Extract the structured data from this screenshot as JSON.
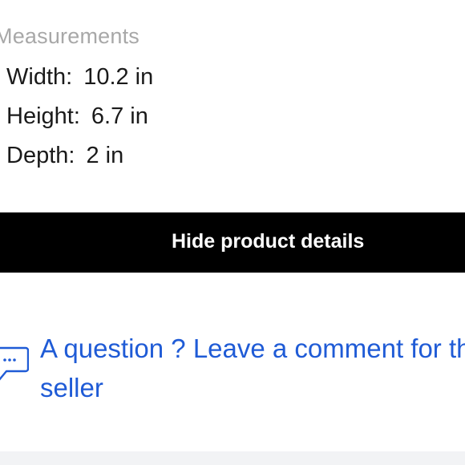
{
  "measurements": {
    "title": "Measurements",
    "rows": [
      {
        "label": "Width:",
        "value": "10.2 in"
      },
      {
        "label": "Height:",
        "value": "6.7 in"
      },
      {
        "label": "Depth:",
        "value": "2 in"
      }
    ]
  },
  "details_toggle": {
    "label": "Hide product details"
  },
  "question": {
    "line1": "A question ? Leave a comment for the",
    "line2": "seller",
    "icon": "comment-icon"
  },
  "colors": {
    "link": "#1f5bd6",
    "button_bg": "#000000",
    "muted": "#a8a8a8"
  }
}
